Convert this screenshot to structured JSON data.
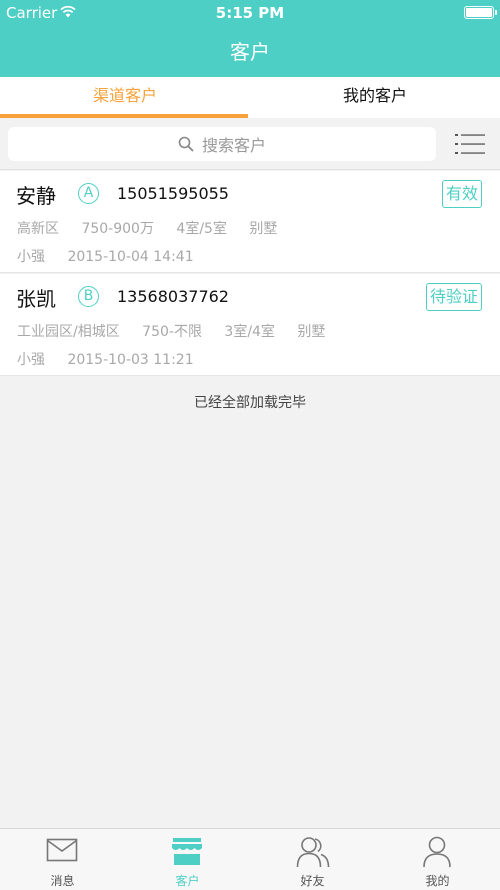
{
  "status_bar": {
    "carrier": "Carrier",
    "time": "5:15 PM"
  },
  "header": {
    "title": "客户"
  },
  "tabs": [
    {
      "label": "渠道客户",
      "active": true
    },
    {
      "label": "我的客户",
      "active": false
    }
  ],
  "search": {
    "placeholder": "搜索客户"
  },
  "customers": [
    {
      "name": "安静",
      "grade": "A",
      "phone": "15051595055",
      "status": "有效",
      "district": "高新区",
      "budget": "750-900万",
      "layout": "4室/5室",
      "type": "别墅",
      "agent": "小强",
      "datetime": "2015-10-04 14:41"
    },
    {
      "name": "张凯",
      "grade": "B",
      "phone": "13568037762",
      "status": "待验证",
      "district": "工业园区/相城区",
      "budget": "750-不限",
      "layout": "3室/4室",
      "type": "别墅",
      "agent": "小强",
      "datetime": "2015-10-03 11:21"
    }
  ],
  "list_footer": "已经全部加载完毕",
  "tabbar": [
    {
      "label": "消息",
      "icon": "mail-icon",
      "active": false
    },
    {
      "label": "客户",
      "icon": "store-icon",
      "active": true
    },
    {
      "label": "好友",
      "icon": "friends-icon",
      "active": false
    },
    {
      "label": "我的",
      "icon": "person-icon",
      "active": false
    }
  ],
  "colors": {
    "primary": "#4ecfc5",
    "accent": "#f7a23a"
  }
}
